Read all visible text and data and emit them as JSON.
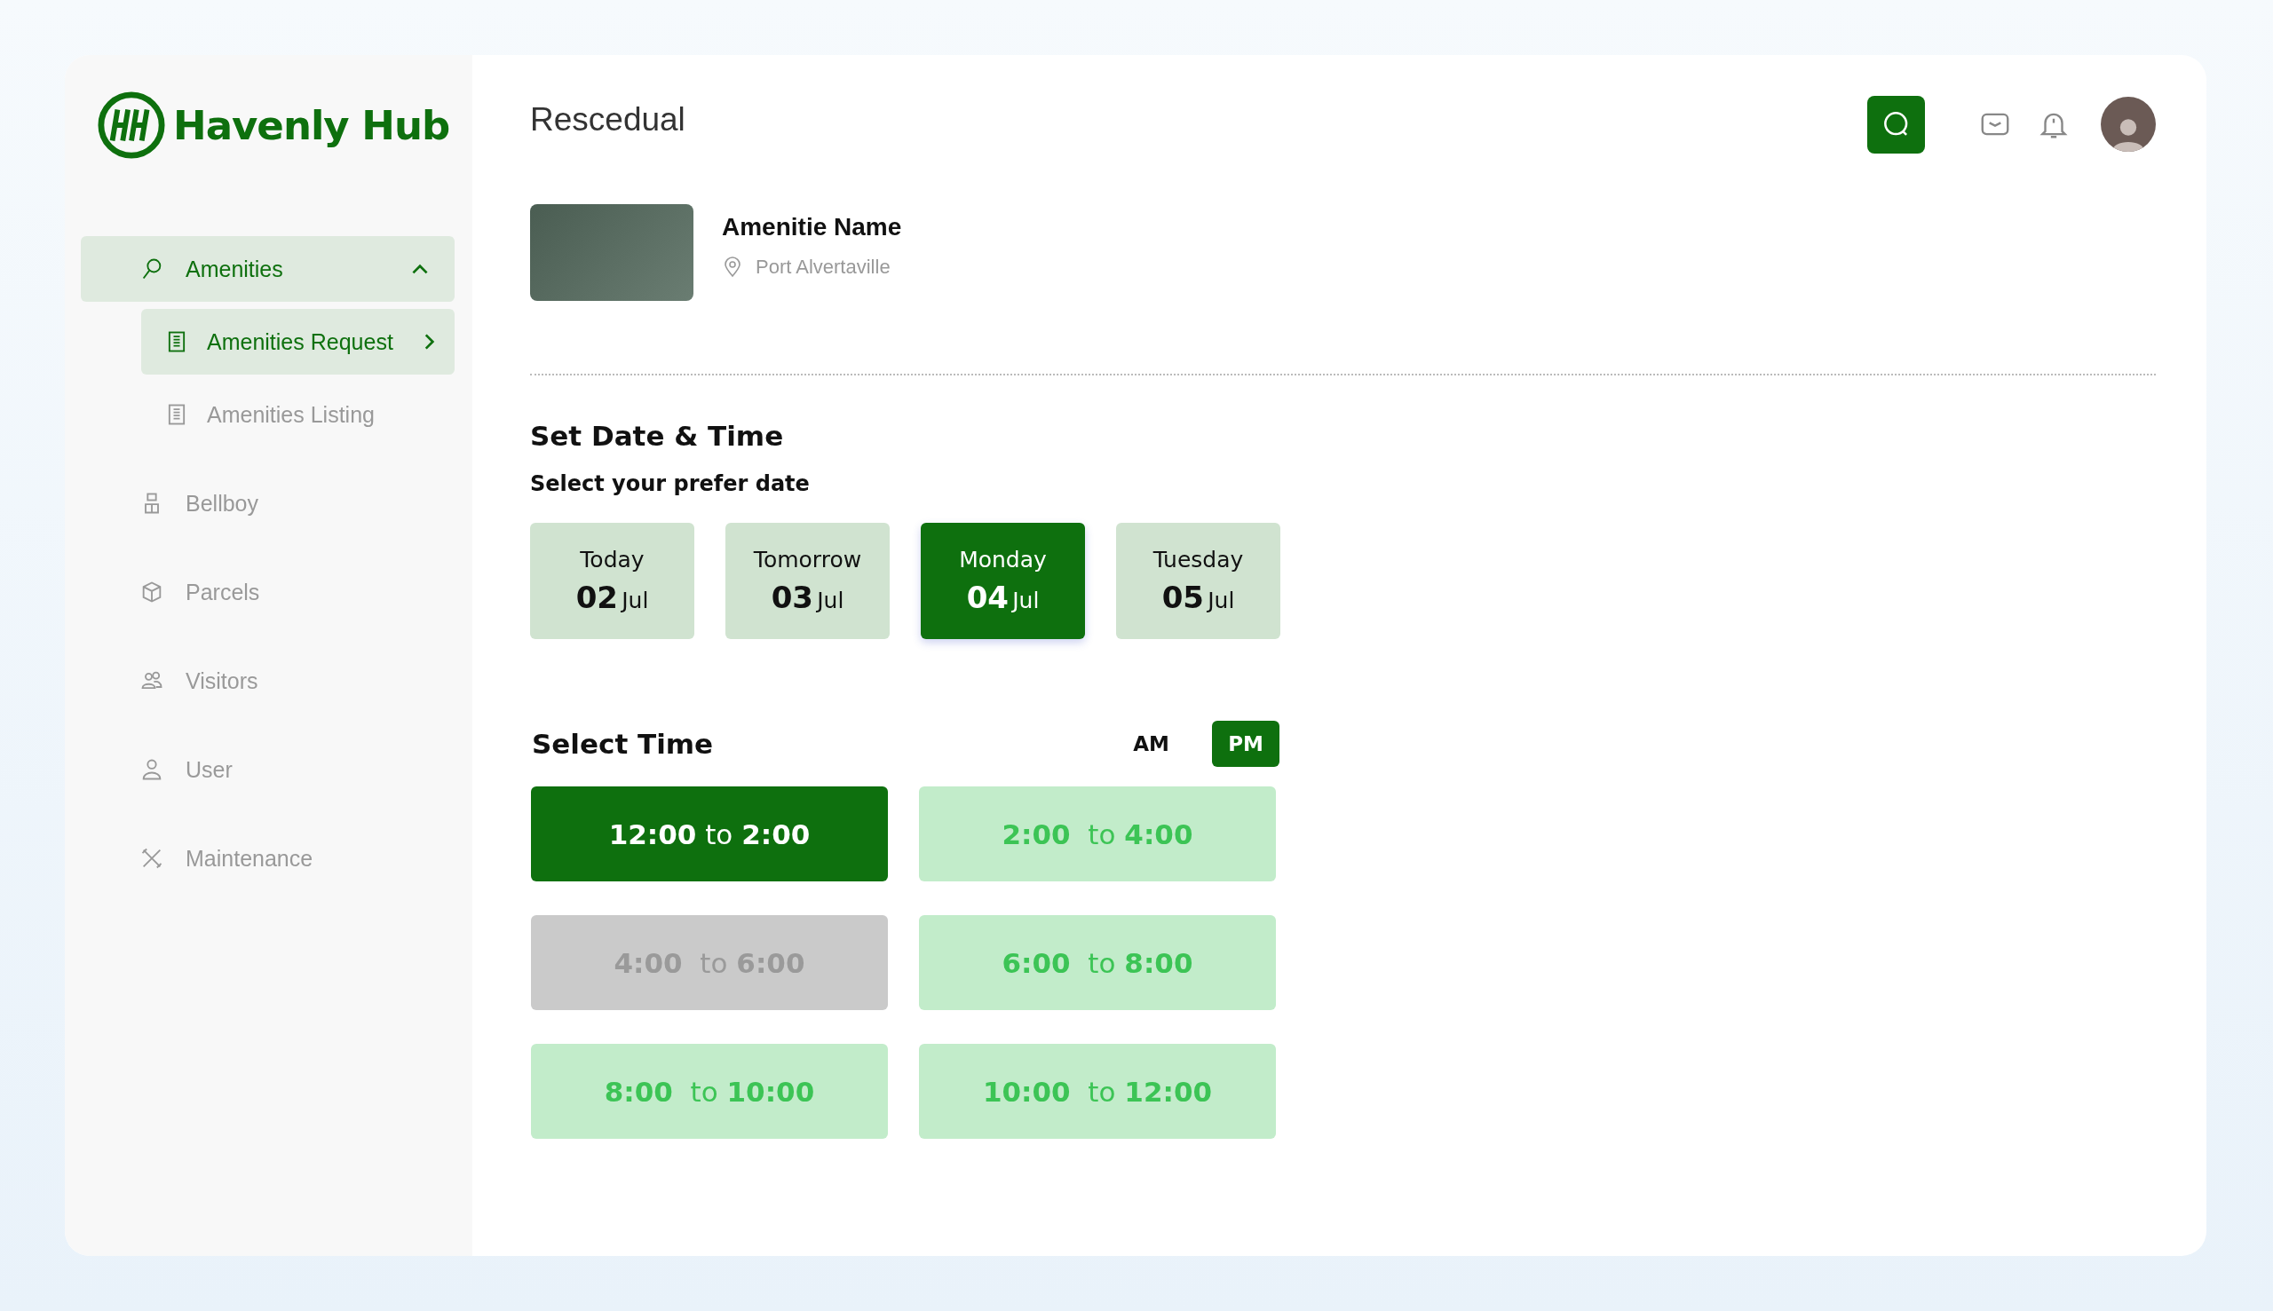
{
  "brand": {
    "name": "Havenly Hub"
  },
  "sidebar": {
    "items": [
      {
        "label": "Amenities",
        "selected": true,
        "expanded": true,
        "children": [
          {
            "label": "Amenities Request",
            "selected": true
          },
          {
            "label": "Amenities Listing",
            "selected": false
          }
        ]
      },
      {
        "label": "Bellboy",
        "selected": false
      },
      {
        "label": "Parcels",
        "selected": false
      },
      {
        "label": "Visitors",
        "selected": false
      },
      {
        "label": "User",
        "selected": false
      },
      {
        "label": "Maintenance",
        "selected": false
      }
    ]
  },
  "header": {
    "title": "Rescedual"
  },
  "amenity": {
    "name": "Amenitie Name",
    "location": "Port Alvertaville"
  },
  "date_section": {
    "title": "Set Date & Time",
    "subtitle": "Select your prefer date",
    "dates": [
      {
        "day": "Today",
        "date": "02",
        "month": "Jul",
        "selected": false
      },
      {
        "day": "Tomorrow",
        "date": "03",
        "month": "Jul",
        "selected": false
      },
      {
        "day": "Monday",
        "date": "04",
        "month": "Jul",
        "selected": true
      },
      {
        "day": "Tuesday",
        "date": "05",
        "month": "Jul",
        "selected": false
      }
    ]
  },
  "time_section": {
    "title": "Select Time",
    "periods": [
      {
        "label": "AM",
        "selected": false
      },
      {
        "label": "PM",
        "selected": true
      }
    ],
    "slots": [
      {
        "label": "**12:00** to **2:00**",
        "selected": true,
        "disabled": false
      },
      {
        "label": "**2:00**  to **4:00**",
        "selected": false,
        "disabled": false
      },
      {
        "label": "**4:00**  to **6:00**",
        "selected": false,
        "disabled": true
      },
      {
        "label": "**6:00**  to **8:00**",
        "selected": false,
        "disabled": false
      },
      {
        "label": "**8:00**  to **10:00**",
        "selected": false,
        "disabled": false
      },
      {
        "label": "**10:00**  to **12:00**",
        "selected": false,
        "disabled": false
      }
    ]
  }
}
